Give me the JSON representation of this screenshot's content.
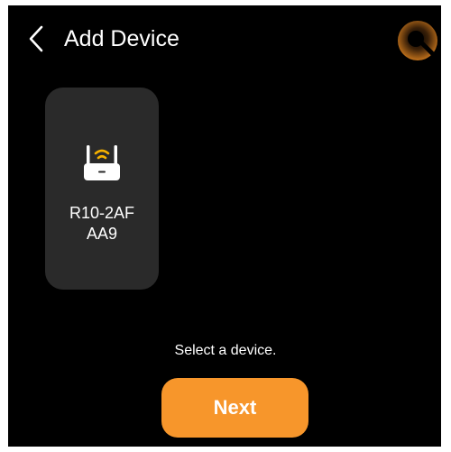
{
  "header": {
    "title": "Add Device",
    "back_icon": "chevron-left-icon",
    "profile_icon": "user-avatar-icon"
  },
  "devices": [
    {
      "name": "R10-2AF\nAA9",
      "icon": "router-icon"
    }
  ],
  "hint": "Select a device.",
  "actions": {
    "next_label": "Next"
  },
  "colors": {
    "background": "#000000",
    "card": "#2a2a2a",
    "accent": "#f7962b",
    "wifi": "#f6b200",
    "text": "#ffffff"
  }
}
